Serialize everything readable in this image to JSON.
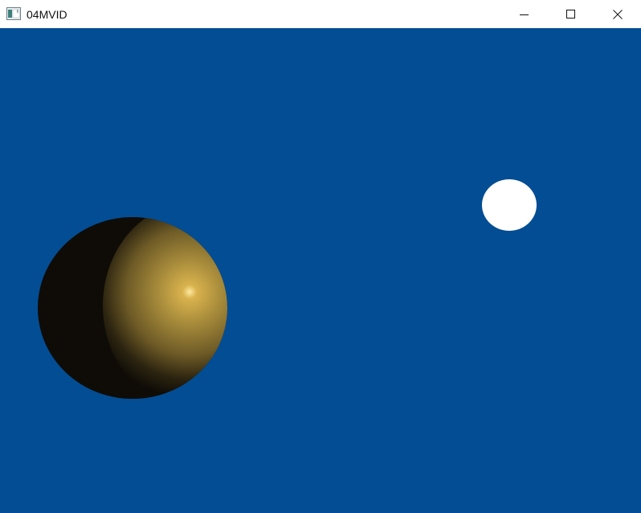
{
  "window": {
    "title": "04MVID",
    "icon": "app-window-icon",
    "controls": {
      "minimize_icon": "minimize-icon",
      "maximize_icon": "maximize-icon",
      "close_icon": "close-icon"
    }
  },
  "scene": {
    "background_color": "#034d94",
    "sphere": {
      "base_color": "#a98d3c",
      "shadow_color": "#0f0c07",
      "highlight_color": "#ffe9a3"
    },
    "light": {
      "color": "#ffffff"
    }
  }
}
